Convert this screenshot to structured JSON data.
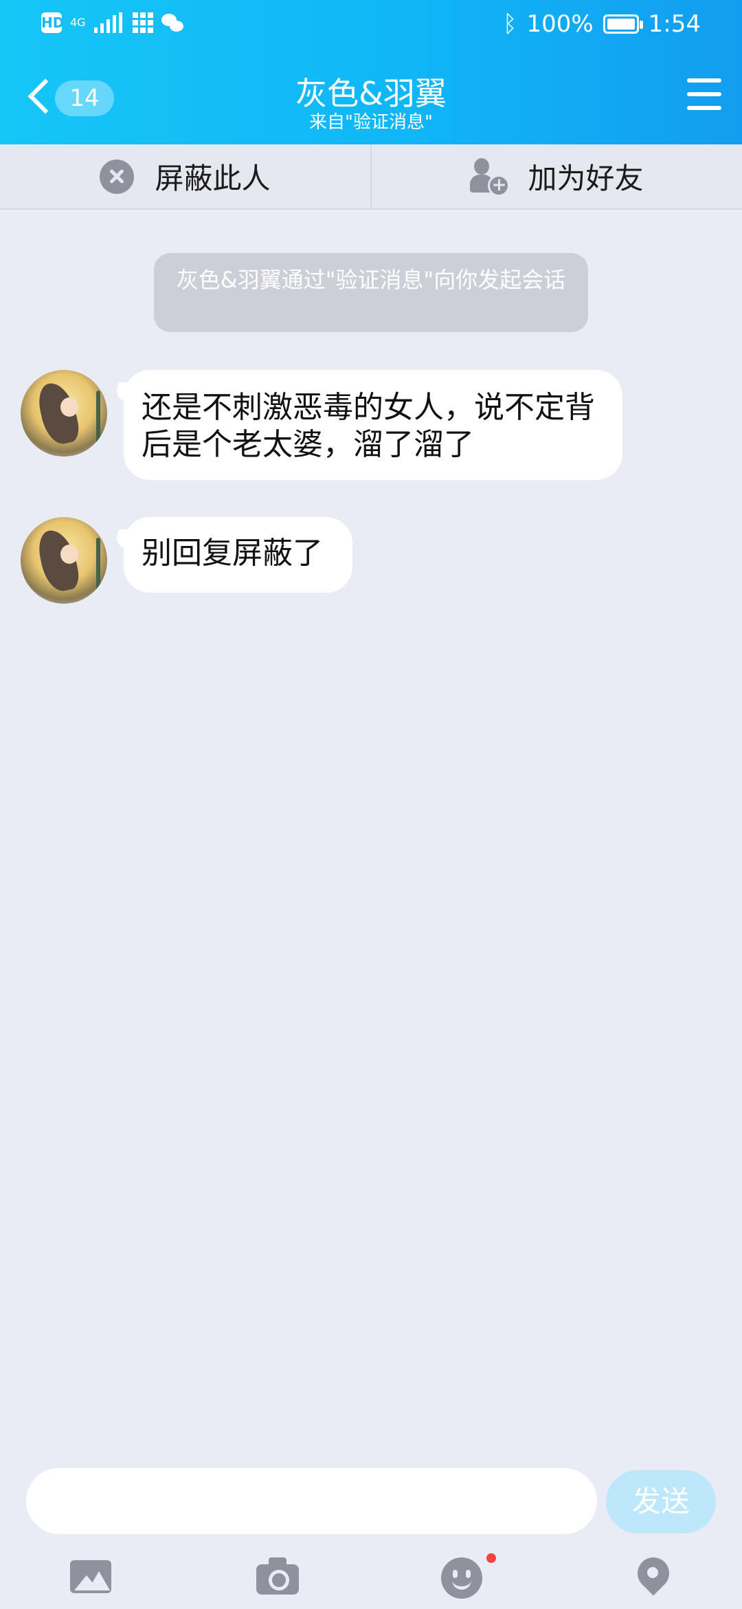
{
  "status_bar": {
    "left_tag": "HD",
    "net": "4G",
    "battery_text": "100%",
    "time": "1:54"
  },
  "header": {
    "unread_count": "14",
    "title": "灰色&羽翼",
    "subtitle": "来自\"验证消息\""
  },
  "actions": {
    "block_label": "屏蔽此人",
    "add_friend_label": "加为好友"
  },
  "chat": {
    "system_message": "灰色&羽翼通过\"验证消息\"向你发起会话",
    "messages": [
      {
        "text": "还是不刺激恶毒的女人，说不定背后是个老太婆，溜了溜了"
      },
      {
        "text": "别回复屏蔽了"
      }
    ]
  },
  "composer": {
    "input_value": "",
    "send_label": "发送"
  },
  "colors": {
    "header_gradient_start": "#16c6f7",
    "header_gradient_end": "#139df0",
    "page_bg": "#eaecf5",
    "notification_dot": "#f2453b"
  }
}
